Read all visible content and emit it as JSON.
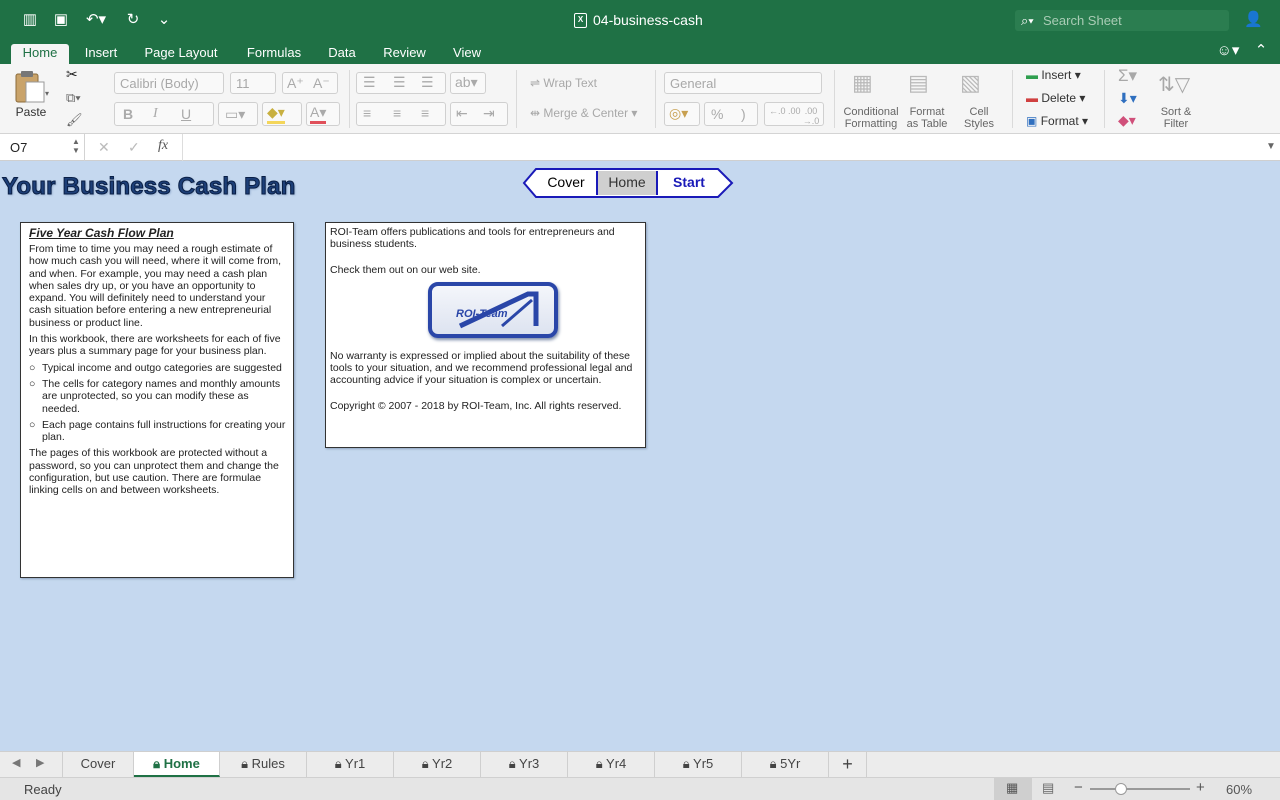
{
  "window": {
    "title": "04-business-cash",
    "search_placeholder": "Search Sheet"
  },
  "ribbon_tabs": [
    "Home",
    "Insert",
    "Page Layout",
    "Formulas",
    "Data",
    "Review",
    "View"
  ],
  "ribbon": {
    "paste": "Paste",
    "font_name": "Calibri (Body)",
    "font_size": "11",
    "bold": "B",
    "italic": "I",
    "underline": "U",
    "wrap_text": "Wrap Text",
    "merge_center": "Merge & Center",
    "number_format": "General",
    "percent": "%",
    "comma": ")",
    "conditional_formatting": "Conditional Formatting",
    "format_as_table": "Format as Table",
    "cell_styles": "Cell Styles",
    "insert": "Insert",
    "delete": "Delete",
    "format": "Format",
    "sort_filter": "Sort & Filter"
  },
  "formula_bar": {
    "name_box": "O7",
    "fx": "fx",
    "value": ""
  },
  "sheet": {
    "title": "Your Business Cash Plan",
    "nav_buttons": [
      "Cover",
      "Home",
      "Start"
    ],
    "panel_left": {
      "heading": "Five Year Cash Flow Plan",
      "p1": "From time to time you may need a rough estimate of how much cash you will need, where it will come from, and when. For example, you may need a cash plan when sales dry up, or you have an opportunity to expand. You will definitely need to understand your cash situation before entering a new entrepreneurial business or product line.",
      "p2": "In this workbook, there are worksheets for each of five years plus a summary page for your business plan.",
      "bullets": [
        "Typical income and outgo categories are suggested",
        "The cells for category names and monthly amounts are unprotected, so you can modify these as needed.",
        "Each page contains full instructions for creating your plan."
      ],
      "p3": "The pages of this workbook are protected without a password, so you can unprotect them and change the configuration, but use caution. There are formulae linking cells on and between worksheets."
    },
    "panel_right": {
      "p1": "ROI-Team offers publications and tools for entrepreneurs and business students.",
      "p2": "Check them out on our web site.",
      "logo_text": "ROI-Team",
      "p3": "No warranty is expressed or implied about the suitability of these tools to your situation, and we recommend professional legal and accounting advice if your situation is complex or uncertain.",
      "p4": "Copyright © 2007 - 2018 by ROI-Team, Inc.  All rights reserved."
    }
  },
  "sheet_tabs": [
    {
      "label": "Cover",
      "locked": false
    },
    {
      "label": "Home",
      "locked": true
    },
    {
      "label": "Rules",
      "locked": true
    },
    {
      "label": "Yr1",
      "locked": true
    },
    {
      "label": "Yr2",
      "locked": true
    },
    {
      "label": "Yr3",
      "locked": true
    },
    {
      "label": "Yr4",
      "locked": true
    },
    {
      "label": "Yr5",
      "locked": true
    },
    {
      "label": "5Yr",
      "locked": true
    }
  ],
  "status": {
    "ready": "Ready",
    "zoom": "60%"
  },
  "colors": {
    "excel_green": "#1f7145",
    "sheet_background": "#c5d8ef",
    "nav_blue": "#1a1ab8"
  }
}
